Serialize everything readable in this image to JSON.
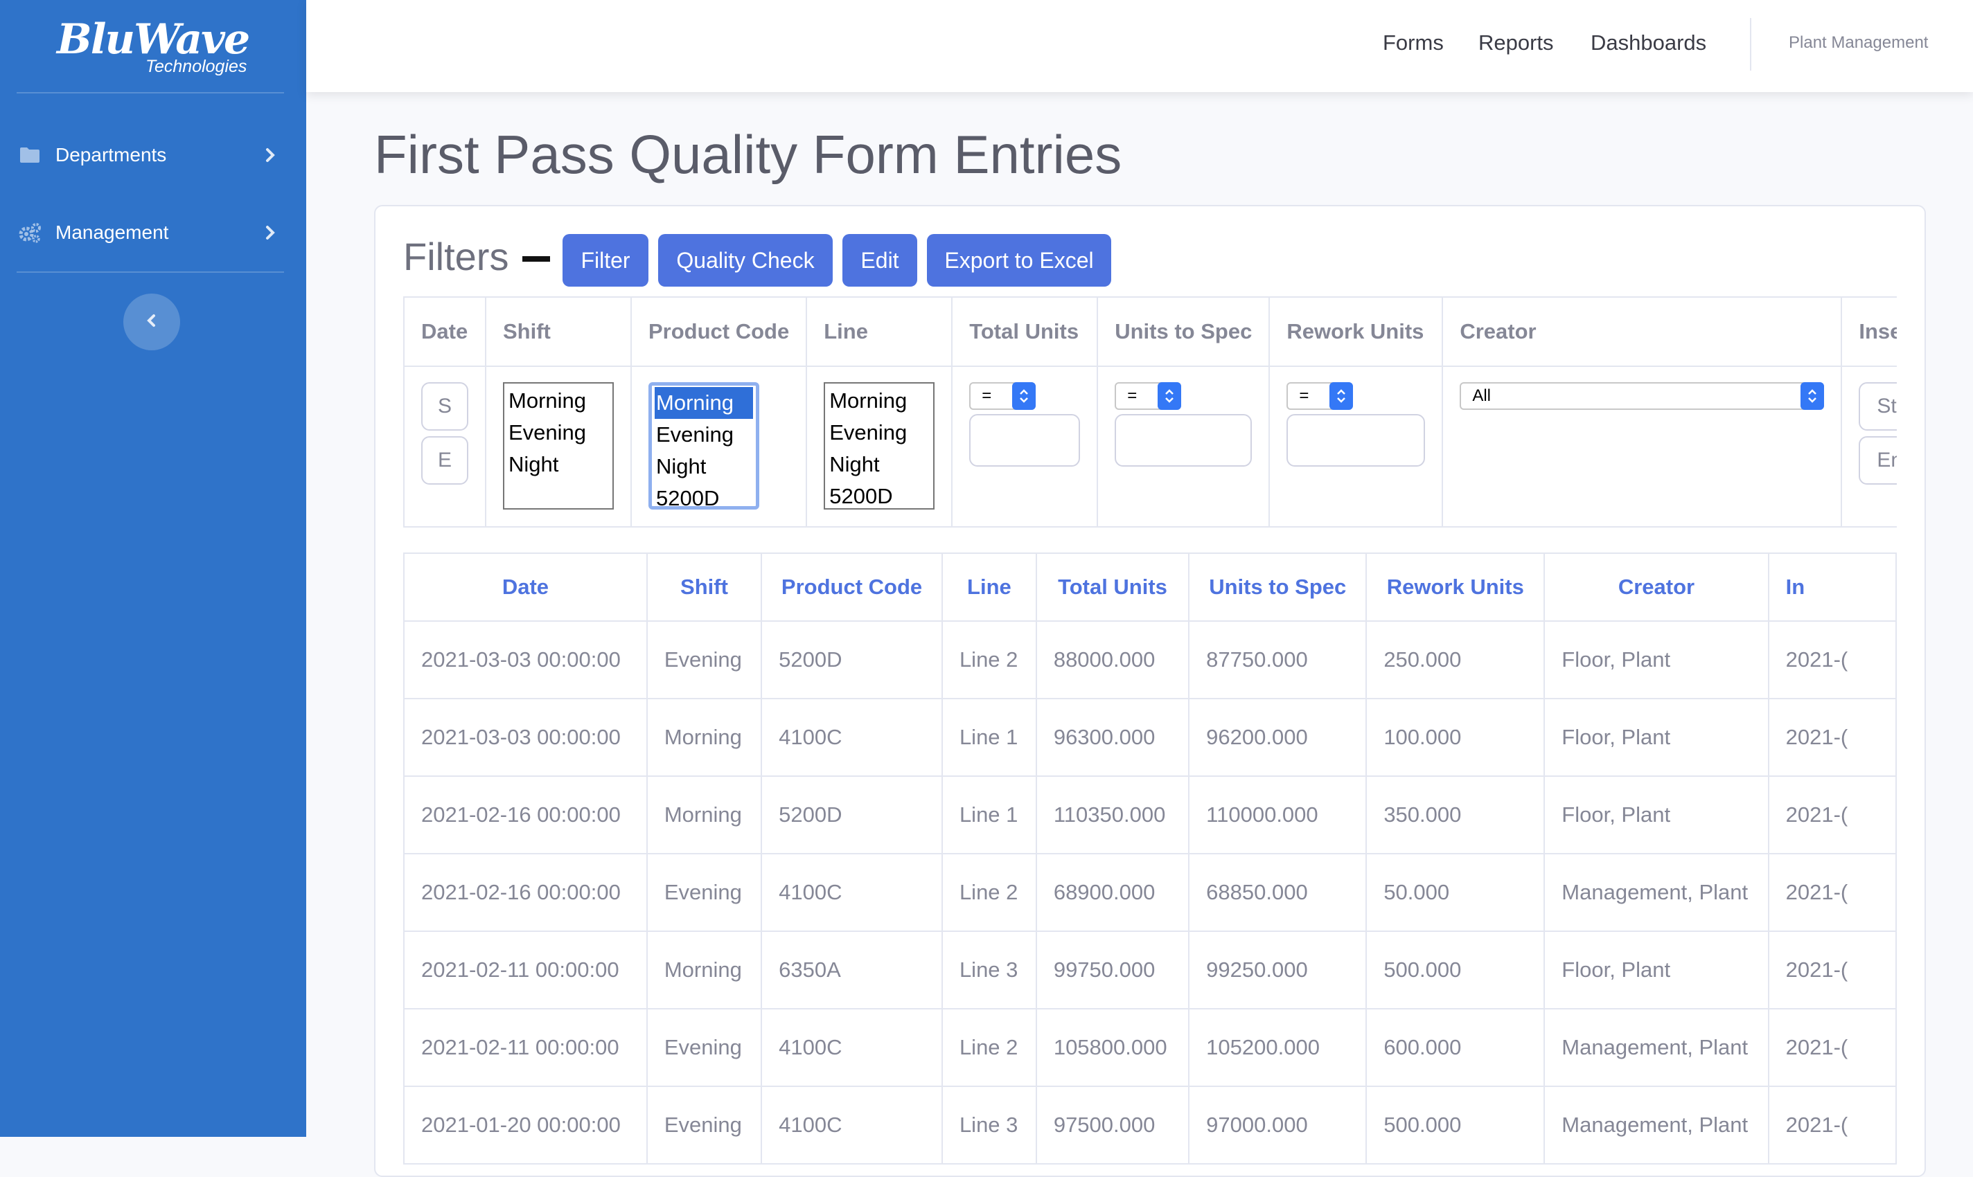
{
  "brand": {
    "name": "BluWave",
    "tagline": "Technologies"
  },
  "sidebar": {
    "items": [
      {
        "label": "Departments",
        "icon": "folder-icon"
      },
      {
        "label": "Management",
        "icon": "cogs-icon"
      }
    ],
    "toggle_icon": "chevron-left-icon"
  },
  "topbar": {
    "nav": [
      "Forms",
      "Reports",
      "Dashboards"
    ],
    "user": "Plant Management"
  },
  "page": {
    "title": "First Pass Quality Form Entries"
  },
  "filters": {
    "label": "Filters",
    "buttons": [
      "Filter",
      "Quality Check",
      "Edit",
      "Export to Excel"
    ],
    "columns": [
      "Date",
      "Shift",
      "Product Code",
      "Line",
      "Total Units",
      "Units to Spec",
      "Rework Units",
      "Creator",
      "Inse"
    ],
    "date_buttons": [
      "S",
      "E"
    ],
    "shift_options": [
      "Morning",
      "Evening",
      "Night"
    ],
    "product_options": [
      "Morning",
      "Evening",
      "Night",
      "5200D"
    ],
    "product_selected": "Morning",
    "line_options": [
      "Morning",
      "Evening",
      "Night",
      "5200D"
    ],
    "operator_value": "=",
    "creator_value": "All",
    "inserted_placeholders": [
      "St",
      "En"
    ]
  },
  "table": {
    "columns": [
      "Date",
      "Shift",
      "Product Code",
      "Line",
      "Total Units",
      "Units to Spec",
      "Rework Units",
      "Creator",
      "In"
    ],
    "rows": [
      [
        "2021-03-03 00:00:00",
        "Evening",
        "5200D",
        "Line 2",
        "88000.000",
        "87750.000",
        "250.000",
        "Floor, Plant",
        "2021-("
      ],
      [
        "2021-03-03 00:00:00",
        "Morning",
        "4100C",
        "Line 1",
        "96300.000",
        "96200.000",
        "100.000",
        "Floor, Plant",
        "2021-("
      ],
      [
        "2021-02-16 00:00:00",
        "Morning",
        "5200D",
        "Line 1",
        "110350.000",
        "110000.000",
        "350.000",
        "Floor, Plant",
        "2021-("
      ],
      [
        "2021-02-16 00:00:00",
        "Evening",
        "4100C",
        "Line 2",
        "68900.000",
        "68850.000",
        "50.000",
        "Management, Plant",
        "2021-("
      ],
      [
        "2021-02-11 00:00:00",
        "Morning",
        "6350A",
        "Line 3",
        "99750.000",
        "99250.000",
        "500.000",
        "Floor, Plant",
        "2021-("
      ],
      [
        "2021-02-11 00:00:00",
        "Evening",
        "4100C",
        "Line 2",
        "105800.000",
        "105200.000",
        "600.000",
        "Management, Plant",
        "2021-("
      ],
      [
        "2021-01-20 00:00:00",
        "Evening",
        "4100C",
        "Line 3",
        "97500.000",
        "97000.000",
        "500.000",
        "Management, Plant",
        "2021-("
      ]
    ]
  },
  "colors": {
    "sidebar": "#2f73c9",
    "primary": "#4e73df",
    "text": "#858796"
  }
}
